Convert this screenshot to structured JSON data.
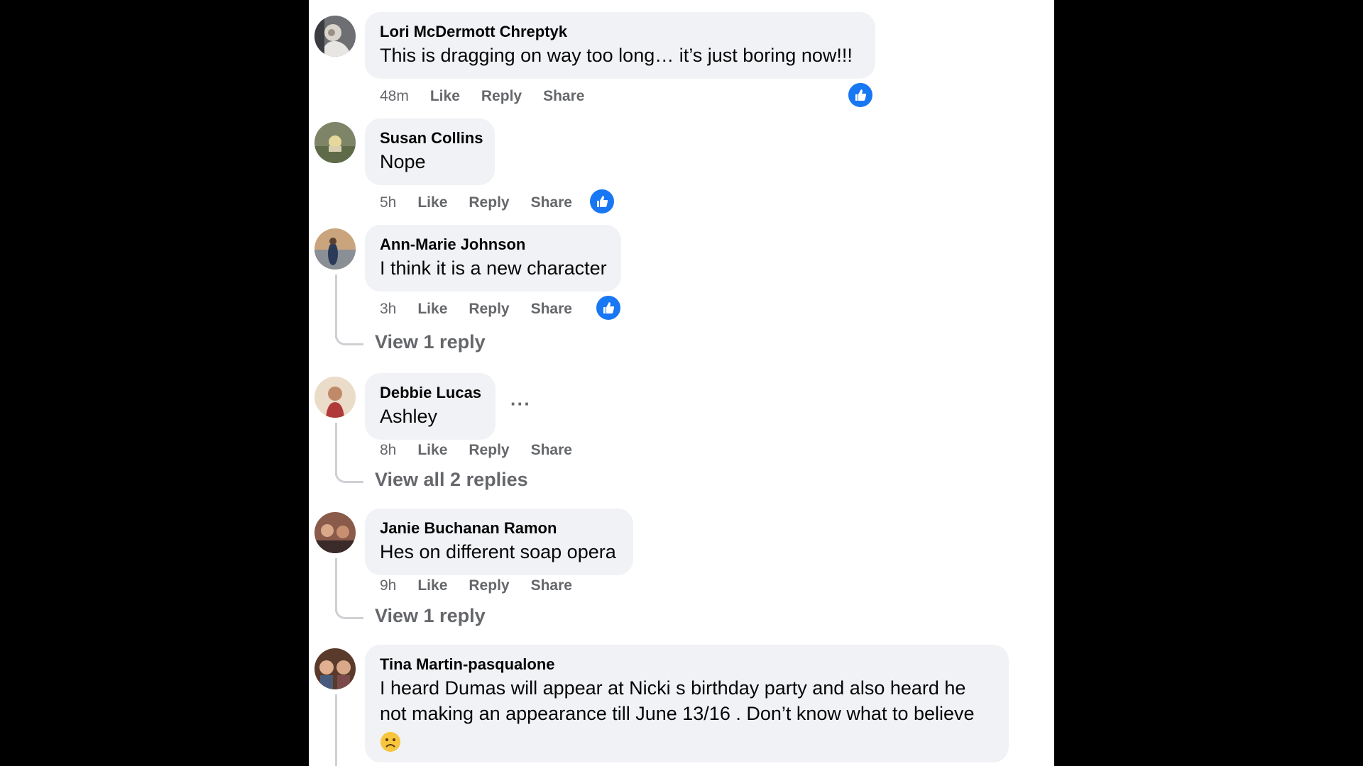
{
  "colors": {
    "like_blue": "#1877f2",
    "bubble_bg": "#f0f2f5",
    "meta_gray": "#65676b"
  },
  "comments": [
    {
      "author": "Lori McDermott Chreptyk",
      "text": "This is dragging on way too long… it’s just boring now!!!",
      "time": "48m",
      "like": "Like",
      "reply": "Reply",
      "share": "Share",
      "reaction": "like-icon"
    },
    {
      "author": "Susan Collins",
      "text": "Nope",
      "time": "5h",
      "like": "Like",
      "reply": "Reply",
      "share": "Share",
      "reaction": "like-icon"
    },
    {
      "author": "Ann-Marie Johnson",
      "text": "I think it is a new character",
      "time": "3h",
      "like": "Like",
      "reply": "Reply",
      "share": "Share",
      "reaction": "like-icon",
      "view_replies": "View 1 reply"
    },
    {
      "author": "Debbie Lucas",
      "text": "Ashley",
      "time": "8h",
      "like": "Like",
      "reply": "Reply",
      "share": "Share",
      "more": "···",
      "view_replies": "View all 2 replies"
    },
    {
      "author": "Janie Buchanan Ramon",
      "text": "Hes on different soap opera",
      "time": "9h",
      "like": "Like",
      "reply": "Reply",
      "share": "Share",
      "view_replies": "View 1 reply"
    },
    {
      "author": "Tina Martin-pasqualone",
      "text": "I heard Dumas will appear at Nicki s birthday party and also heard he not making an appearance till June 13/16 . Don’t know what to believe",
      "emoji": "frowning-face-emoji"
    }
  ]
}
